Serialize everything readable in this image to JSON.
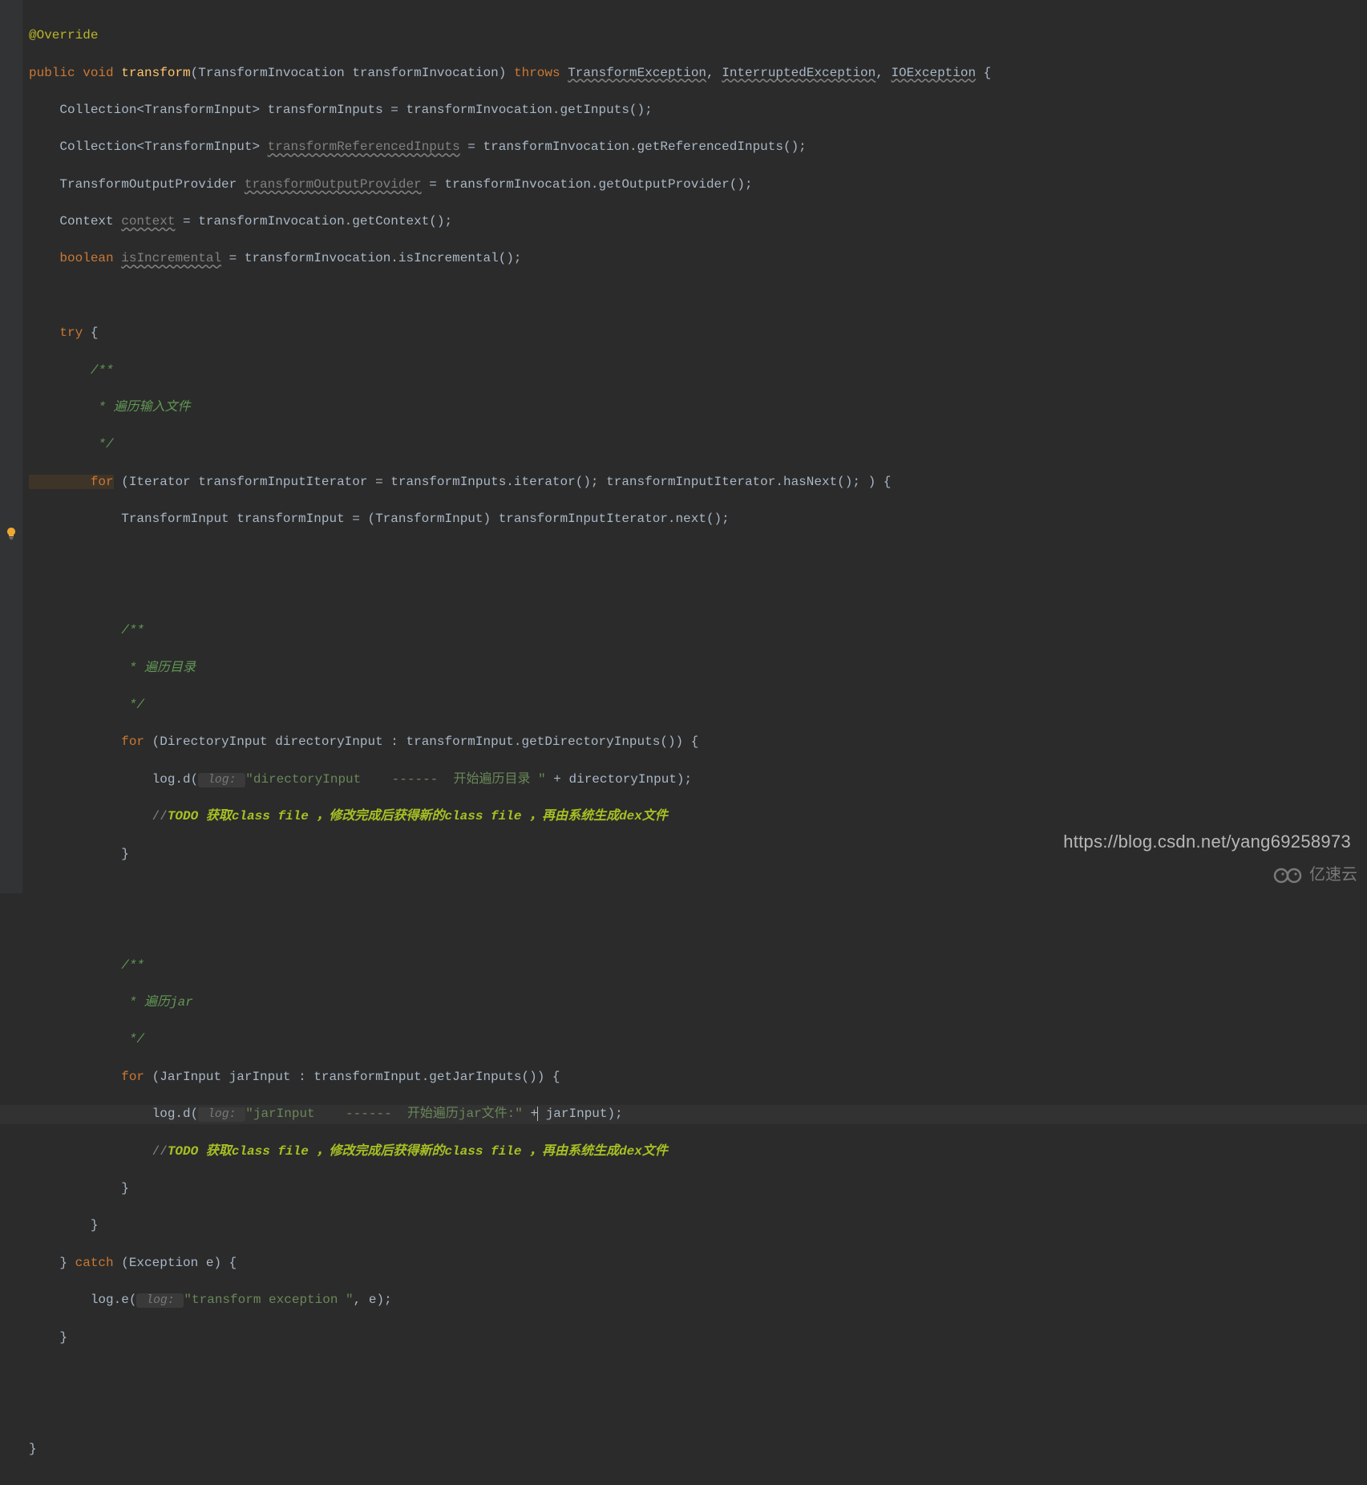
{
  "code": {
    "l1_annotation": "@Override",
    "l2_kw1": "public",
    "l2_kw2": "void",
    "l2_method": "transform",
    "l2_param_type": "TransformInvocation",
    "l2_param_name": "transformInvocation",
    "l2_throws": "throws",
    "l2_ex1": "TransformException",
    "l2_ex2": "InterruptedException",
    "l2_ex3": "IOException",
    "l3": "    Collection<TransformInput> transformInputs = transformInvocation.getInputs();",
    "l4_a": "    Collection<TransformInput> ",
    "l4_u": "transformReferencedInputs",
    "l4_b": " = transformInvocation.getReferencedInputs();",
    "l5_a": "    TransformOutputProvider ",
    "l5_u": "transformOutputProvider",
    "l5_b": " = transformInvocation.getOutputProvider();",
    "l6_a": "    Context ",
    "l6_u": "context",
    "l6_b": " = transformInvocation.getContext();",
    "l7_kw": "    boolean",
    "l7_u": "isIncremental",
    "l7_b": " = transformInvocation.isIncremental();",
    "l9_try": "    try",
    "l9_brace": " {",
    "l10": "        /**",
    "l11": "         * 遍历输入文件",
    "l12": "         */",
    "l13_for": "        for",
    "l13_rest": " (Iterator transformInputIterator = transformInputs.iterator(); transformInputIterator.hasNext(); ) {",
    "l14": "            TransformInput transformInput = (TransformInput) transformInputIterator.next();",
    "l17": "            /**",
    "l18": "             * 遍历目录",
    "l19": "             */",
    "l20_for": "            for",
    "l20_rest": " (DirectoryInput directoryInput : transformInput.getDirectoryInputs()) {",
    "l21_a": "                log.d(",
    "l21_hint": " log: ",
    "l21_str": "\"directoryInput    ------  开始遍历目录 \"",
    "l21_b": " + directoryInput);",
    "l22_c": "                //",
    "l22_todo": "TODO 获取class file ，修改完成后获得新的class file ，再由系统生成dex文件",
    "l23": "            }",
    "l26": "            /**",
    "l27": "             * 遍历jar",
    "l28": "             */",
    "l29_for": "            for",
    "l29_rest": " (JarInput jarInput : transformInput.getJarInputs()) {",
    "l30_a": "                log.d(",
    "l30_hint": " log: ",
    "l30_str": "\"jarInput    ------  开始遍历jar文件:\"",
    "l30_b": " +",
    "l30_c": " jarInput);",
    "l31_c": "                //",
    "l31_todo": "TODO 获取class file ，修改完成后获得新的class file ，再由系统生成dex文件",
    "l32": "            }",
    "l33": "        }",
    "l34_a": "    } ",
    "l34_catch": "catch",
    "l34_b": " (Exception e) {",
    "l35_a": "        log.e(",
    "l35_hint": " log: ",
    "l35_str": "\"transform exception \"",
    "l35_b": ", e);",
    "l36": "    }",
    "l39": "}"
  },
  "watermark": {
    "url": "https://blog.csdn.net/yang69258973",
    "text": "亿速云"
  }
}
